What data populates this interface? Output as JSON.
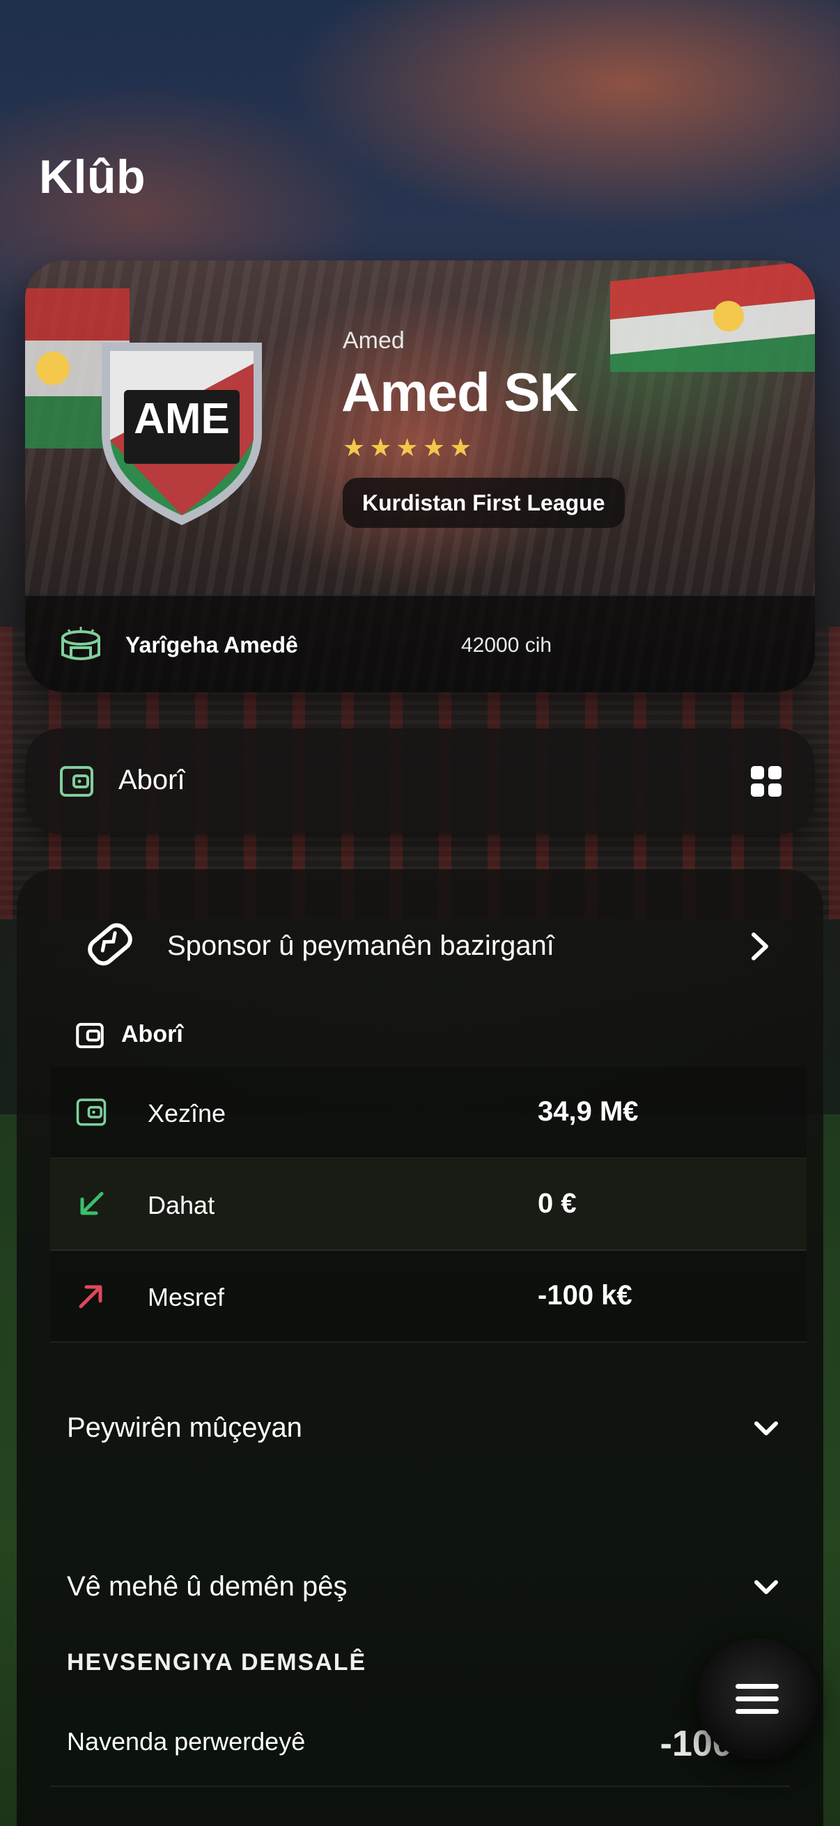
{
  "page": {
    "title": "Klûb"
  },
  "club": {
    "city": "Amed",
    "name": "Amed SK",
    "crest_text": "AME",
    "stars": "★★★★★",
    "league": "Kurdistan First League",
    "stadium_name": "Yarîgeha Amedê",
    "stadium_capacity": "42000 cih"
  },
  "abori_bar": {
    "label": "Aborî"
  },
  "sponsor": {
    "label": "Sponsor û peymanên bazirganî"
  },
  "finance": {
    "title": "Aborî",
    "rows": [
      {
        "label": "Xezîne",
        "value": "34,9 M€",
        "icon": "wallet-icon"
      },
      {
        "label": "Dahat",
        "value": "0 €",
        "icon": "arrow-down-left-icon"
      },
      {
        "label": "Mesref",
        "value": "-100 k€",
        "icon": "arrow-up-right-icon"
      }
    ]
  },
  "sections": {
    "staff": "Peywirên mûçeyan",
    "next_month": "Vê mehê û demên pêş"
  },
  "season_balance": {
    "title": "HEVSENGIYA DEMSALÊ",
    "training_center_label": "Navenda perwerdeyê",
    "training_center_value": "-100 k€"
  },
  "colors": {
    "accent_green": "#7fd09c",
    "income_green": "#3bbf6a",
    "expense_red": "#e0485a",
    "star_gold": "#f3c84c"
  }
}
